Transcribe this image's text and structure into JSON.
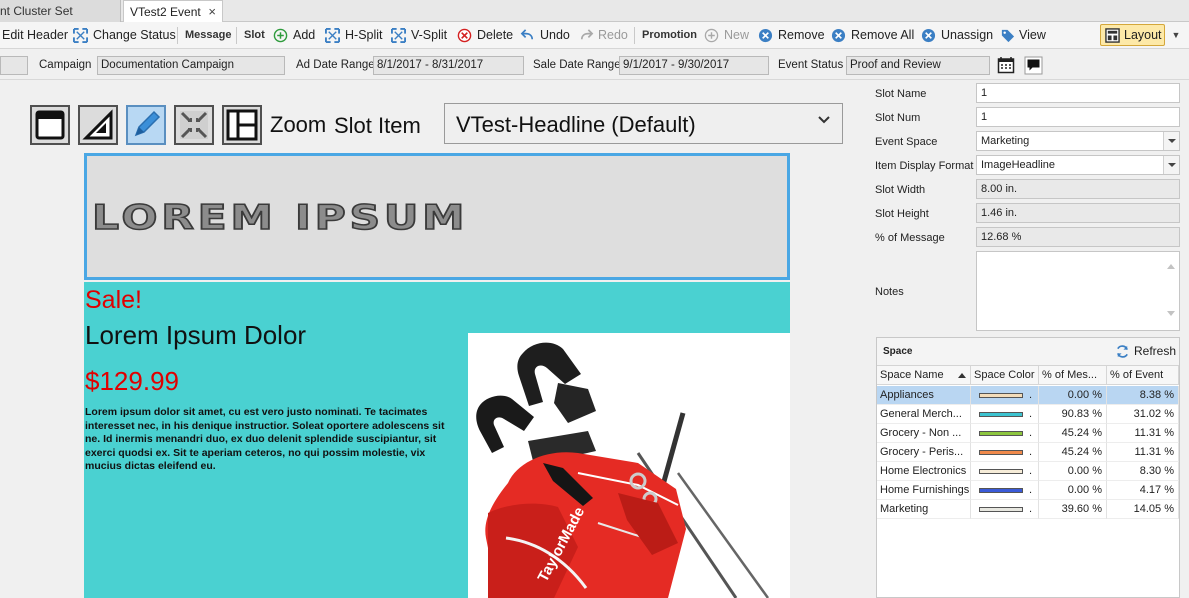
{
  "tabs": [
    {
      "label": "nt Cluster Set Validation",
      "active": false
    },
    {
      "label": "VTest2 Event",
      "active": true,
      "close": "×"
    }
  ],
  "toolbar": {
    "edit_header": "Edit Header",
    "change_status": "Change Status",
    "message_section": "Message",
    "slot_section": "Slot",
    "add": "Add",
    "h_split": "H-Split",
    "v_split": "V-Split",
    "delete": "Delete",
    "undo": "Undo",
    "redo": "Redo",
    "promotion_section": "Promotion",
    "new": "New",
    "remove": "Remove",
    "remove_all": "Remove All",
    "unassign": "Unassign",
    "view": "View",
    "layout": "Layout"
  },
  "header_fields": {
    "campaign_label": "Campaign",
    "campaign_value": "Documentation Campaign",
    "ad_date_label": "Ad Date Range",
    "ad_date_value": "8/1/2017 - 8/31/2017",
    "sale_date_label": "Sale Date Range",
    "sale_date_value": "9/1/2017 - 9/30/2017",
    "event_status_label": "Event Status",
    "event_status_value": "Proof and Review"
  },
  "canvas": {
    "zoom_label": "Zoom",
    "slot_item_label": "Slot Item",
    "slot_item_value": "VTest-Headline (Default)",
    "headline": "LOREM IPSUM",
    "sale": "Sale!",
    "product_name": "Lorem Ipsum Dolor",
    "price": "$129.99",
    "body": "Lorem ipsum dolor sit amet, cu est vero justo nominati. Te tacimates interesset nec, in his denique instructior. Soleat oportere adolescens sit ne. Id inermis menandri duo, ex duo delenit splendide suscipiantur, sit exerci quodsi ex. Sit te aperiam ceteros, no qui possim molestie, vix mucius dictas eleifend eu.",
    "brand_on_bag": "TaylorMade"
  },
  "properties": {
    "slot_name_label": "Slot Name",
    "slot_name": "1",
    "slot_num_label": "Slot Num",
    "slot_num": "1",
    "event_space_label": "Event Space",
    "event_space": "Marketing",
    "item_display_label": "Item Display Format",
    "item_display": "ImageHeadline",
    "slot_width_label": "Slot Width",
    "slot_width": "8.00 in.",
    "slot_height_label": "Slot Height",
    "slot_height": "1.46 in.",
    "pct_message_label": "% of Message",
    "pct_message": "12.68 %",
    "notes_label": "Notes",
    "notes": ""
  },
  "space": {
    "title": "Space",
    "refresh": "Refresh",
    "columns": [
      "Space Name",
      "Space Color",
      "% of Mes...",
      "% of Event"
    ],
    "rows": [
      {
        "name": "Appliances",
        "color": "#f3dcb9",
        "dot": ".",
        "pct_message": "0.00 %",
        "pct_event": "8.38 %",
        "selected": true
      },
      {
        "name": "General Merch...",
        "color": "#3cc3d0",
        "dot": ".",
        "pct_message": "90.83 %",
        "pct_event": "31.02 %",
        "selected": false
      },
      {
        "name": "Grocery - Non ...",
        "color": "#8dc63f",
        "dot": ".",
        "pct_message": "45.24 %",
        "pct_event": "11.31 %",
        "selected": false
      },
      {
        "name": "Grocery - Peris...",
        "color": "#f08a4b",
        "dot": ".",
        "pct_message": "45.24 %",
        "pct_event": "11.31 %",
        "selected": false
      },
      {
        "name": "Home Electronics",
        "color": "#f6ecd8",
        "dot": ".",
        "pct_message": "0.00 %",
        "pct_event": "8.30 %",
        "selected": false
      },
      {
        "name": "Home Furnishings",
        "color": "#3a5ad8",
        "dot": ".",
        "pct_message": "0.00 %",
        "pct_event": "4.17 %",
        "selected": false
      },
      {
        "name": "Marketing",
        "color": "#e7e7e0",
        "dot": ".",
        "pct_message": "39.60 %",
        "pct_event": "14.05 %",
        "selected": false
      }
    ]
  }
}
